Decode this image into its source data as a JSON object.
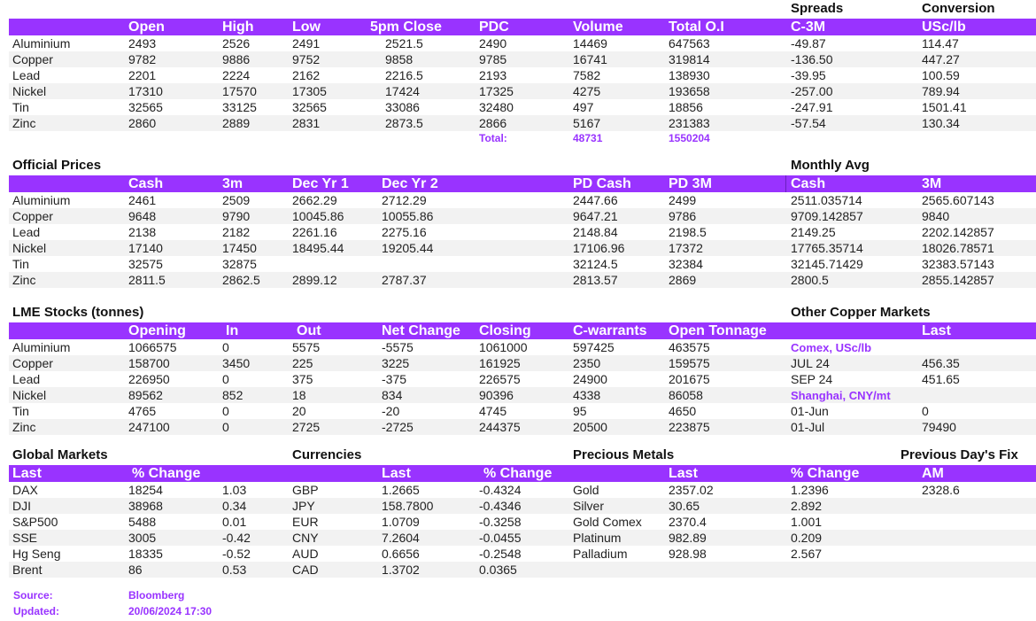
{
  "spot": {
    "titles": {
      "spreads": "Spreads",
      "conversion": "Conversion"
    },
    "columns": [
      "Open",
      "High",
      "Low",
      "5pm Close",
      "PDC",
      "Volume",
      "Total O.I",
      "C-3M",
      "USc/lb"
    ],
    "rows": [
      [
        "Aluminium",
        "2493",
        "2526",
        "2491",
        "2521.5",
        "2490",
        "14469",
        "647563",
        "-49.87",
        "114.47"
      ],
      [
        "Copper",
        "9782",
        "9886",
        "9752",
        "9858",
        "9785",
        "16741",
        "319814",
        "-136.50",
        "447.27"
      ],
      [
        "Lead",
        "2201",
        "2224",
        "2162",
        "2216.5",
        "2193",
        "7582",
        "138930",
        "-39.95",
        "100.59"
      ],
      [
        "Nickel",
        "17310",
        "17570",
        "17305",
        "17424",
        "17325",
        "4275",
        "193658",
        "-257.00",
        "789.94"
      ],
      [
        "Tin",
        "32565",
        "33125",
        "32565",
        "33086",
        "32480",
        "497",
        "18856",
        "-247.91",
        "1501.41"
      ],
      [
        "Zinc",
        "2860",
        "2889",
        "2831",
        "2873.5",
        "2866",
        "5167",
        "231383",
        "-57.54",
        "130.34"
      ]
    ],
    "total": {
      "label": "Total:",
      "volume": "48731",
      "oi": "1550204"
    }
  },
  "official": {
    "title": "Official Prices",
    "monthly_title": "Monthly Avg",
    "columns": [
      "Cash",
      "3m",
      "Dec Yr 1",
      "Dec Yr 2",
      "PD Cash",
      "PD 3M",
      "Cash",
      "3M"
    ],
    "rows": [
      [
        "Aluminium",
        "2461",
        "2509",
        "2662.29",
        "2712.29",
        "2447.66",
        "2499",
        "2511.035714",
        "2565.607143"
      ],
      [
        "Copper",
        "9648",
        "9790",
        "10045.86",
        "10055.86",
        "9647.21",
        "9786",
        "9709.142857",
        "9840"
      ],
      [
        "Lead",
        "2138",
        "2182",
        "2261.16",
        "2275.16",
        "2148.84",
        "2198.5",
        "2149.25",
        "2202.142857"
      ],
      [
        "Nickel",
        "17140",
        "17450",
        "18495.44",
        "19205.44",
        "17106.96",
        "17372",
        "17765.35714",
        "18026.78571"
      ],
      [
        "Tin",
        "32575",
        "32875",
        "",
        "",
        "32124.5",
        "32384",
        "32145.71429",
        "32383.57143"
      ],
      [
        "Zinc",
        "2811.5",
        "2862.5",
        "2899.12",
        "2787.37",
        "2813.57",
        "2869",
        "2800.5",
        "2855.142857"
      ]
    ]
  },
  "stocks": {
    "title": "LME Stocks (tonnes)",
    "other_title": "Other Copper Markets",
    "columns": [
      "Opening",
      "In",
      "Out",
      "Net Change",
      "Closing",
      "C-warrants",
      "Open Tonnage",
      "Last"
    ],
    "rows": [
      [
        "Aluminium",
        "1066575",
        "0",
        "5575",
        "-5575",
        "1061000",
        "597425",
        "463575"
      ],
      [
        "Copper",
        "158700",
        "3450",
        "225",
        "3225",
        "161925",
        "2350",
        "159575"
      ],
      [
        "Lead",
        "226950",
        "0",
        "375",
        "-375",
        "226575",
        "24900",
        "201675"
      ],
      [
        "Nickel",
        "89562",
        "852",
        "18",
        "834",
        "90396",
        "4338",
        "86058"
      ],
      [
        "Tin",
        "4765",
        "0",
        "20",
        "-20",
        "4745",
        "95",
        "4650"
      ],
      [
        "Zinc",
        "247100",
        "0",
        "2725",
        "-2725",
        "244375",
        "20500",
        "223875"
      ]
    ],
    "other": [
      {
        "label": "Comex, USc/lb",
        "value": "",
        "header": true
      },
      {
        "label": "JUL 24",
        "value": "456.35",
        "header": false
      },
      {
        "label": "SEP 24",
        "value": "451.65",
        "header": false
      },
      {
        "label": "Shanghai, CNY/mt",
        "value": "",
        "header": true
      },
      {
        "label": "01-Jun",
        "value": "0",
        "header": false
      },
      {
        "label": "01-Jul",
        "value": "79490",
        "header": false
      }
    ]
  },
  "global": {
    "titles": {
      "global": "Global Markets",
      "currencies": "Currencies",
      "precious": "Precious Metals",
      "fix": "Previous Day's Fix"
    },
    "columns": [
      "Last",
      "% Change",
      "Last",
      "% Change",
      "Last",
      "% Change",
      "AM"
    ],
    "indices": [
      [
        "DAX",
        "18254",
        "1.03"
      ],
      [
        "DJI",
        "38968",
        "0.34"
      ],
      [
        "S&P500",
        "5488",
        "0.01"
      ],
      [
        "SSE",
        "3005",
        "-0.42"
      ],
      [
        "Hg Seng",
        "18335",
        "-0.52"
      ],
      [
        "Brent",
        "86",
        "0.53"
      ]
    ],
    "currencies": [
      [
        "GBP",
        "1.2665",
        "-0.4324"
      ],
      [
        "JPY",
        "158.7800",
        "-0.4346"
      ],
      [
        "EUR",
        "1.0709",
        "-0.3258"
      ],
      [
        "CNY",
        "7.2604",
        "-0.0455"
      ],
      [
        "AUD",
        "0.6656",
        "-0.2548"
      ],
      [
        "CAD",
        "1.3702",
        "0.0365"
      ]
    ],
    "precious": [
      [
        "Gold",
        "2357.02",
        "1.2396",
        "2328.6"
      ],
      [
        "Silver",
        "30.65",
        "2.892",
        ""
      ],
      [
        "Gold Comex",
        "2370.4",
        "1.001",
        ""
      ],
      [
        "Platinum",
        "982.89",
        "0.209",
        ""
      ],
      [
        "Palladium",
        "928.98",
        "2.567",
        ""
      ],
      [
        "",
        "",
        "",
        ""
      ]
    ]
  },
  "footer": {
    "source_label": "Source:",
    "source_value": "Bloomberg",
    "updated_label": "Updated:",
    "updated_value": "20/06/2024 17:30"
  },
  "colors": {
    "accent": "#9933ff",
    "alt_row": "#f2f2f2"
  }
}
